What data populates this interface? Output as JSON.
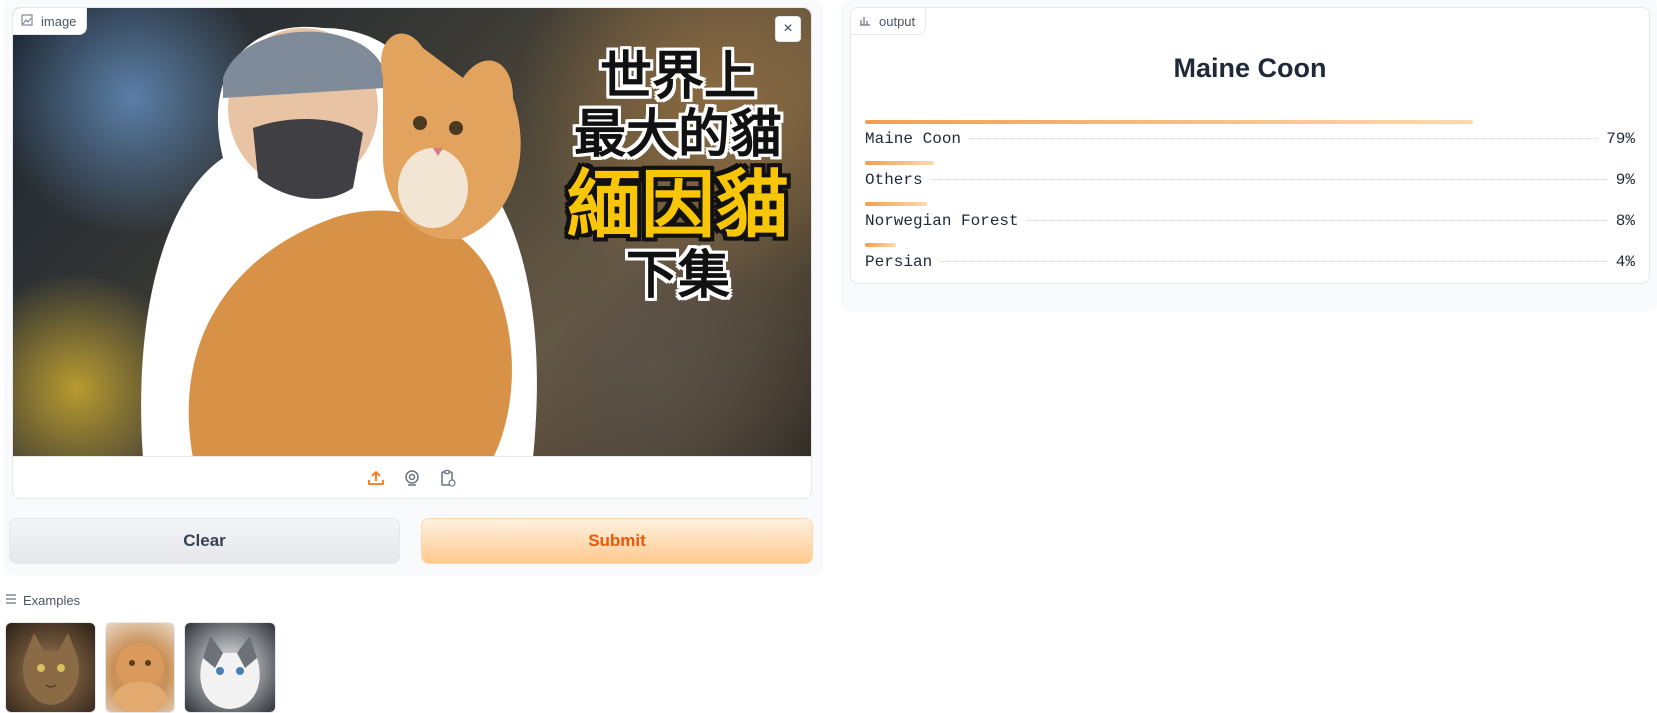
{
  "input": {
    "label": "image",
    "overlay_text": {
      "line1": "世界上",
      "line2": "最大的貓",
      "line3": "緬因貓",
      "line4": "下集"
    },
    "close_symbol": "×",
    "sources": [
      "upload-icon",
      "webcam-icon",
      "clipboard-icon"
    ]
  },
  "buttons": {
    "clear": "Clear",
    "submit": "Submit"
  },
  "examples": {
    "label": "Examples",
    "items": [
      "example-maine-coon",
      "example-persian",
      "example-ragdoll"
    ]
  },
  "output": {
    "label": "output",
    "title": "Maine Coon",
    "confidences": [
      {
        "label": "Maine Coon",
        "value": "79%",
        "fraction": 0.79
      },
      {
        "label": "Others",
        "value": "9%",
        "fraction": 0.09
      },
      {
        "label": "Norwegian Forest",
        "value": "8%",
        "fraction": 0.08
      },
      {
        "label": "Persian",
        "value": "4%",
        "fraction": 0.04
      }
    ]
  },
  "colors": {
    "accent": "#f97316",
    "submit_text": "#ea580c",
    "bar_start": "#f59e4b",
    "bar_end": "#fcd9b1"
  }
}
